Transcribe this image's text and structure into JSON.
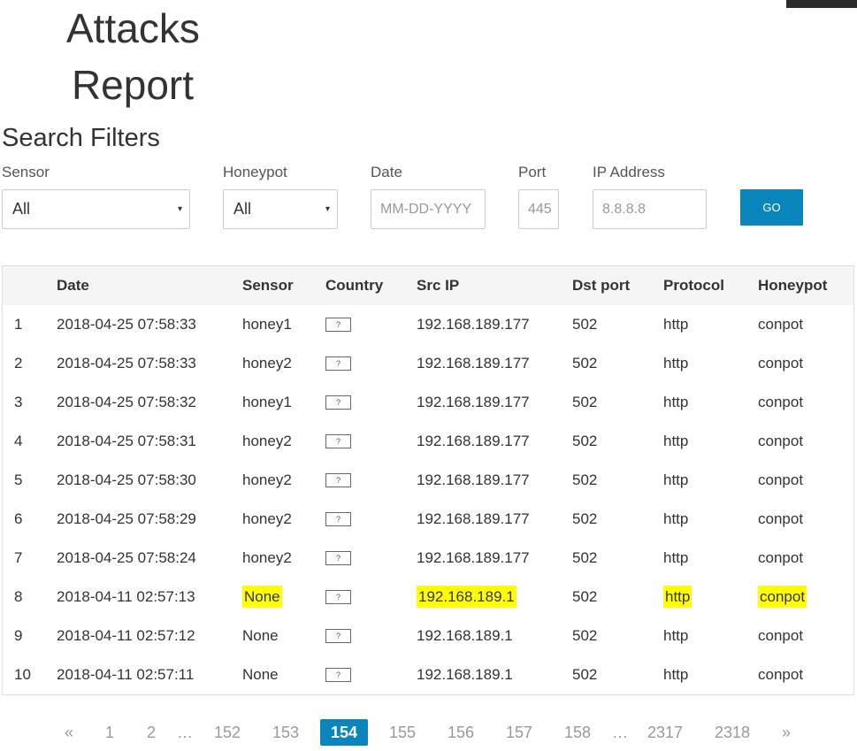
{
  "page": {
    "title_line1": "Attacks",
    "title_line2": "Report",
    "filters_title": "Search Filters"
  },
  "filters": {
    "sensor": {
      "label": "Sensor",
      "value": "All"
    },
    "honeypot": {
      "label": "Honeypot",
      "value": "All"
    },
    "date": {
      "label": "Date",
      "placeholder": "MM-DD-YYYY"
    },
    "port": {
      "label": "Port",
      "placeholder": "445"
    },
    "ip": {
      "label": "IP Address",
      "placeholder": "8.8.8.8"
    },
    "go_label": "GO"
  },
  "table": {
    "headers": [
      "",
      "Date",
      "Sensor",
      "Country",
      "Src IP",
      "Dst port",
      "Protocol",
      "Honeypot"
    ],
    "country_flag_glyph": "?",
    "rows": [
      [
        "1",
        "2018-04-25 07:58:33",
        "honey1",
        "192.168.189.177",
        "502",
        "http",
        "conpot"
      ],
      [
        "2",
        "2018-04-25 07:58:33",
        "honey2",
        "192.168.189.177",
        "502",
        "http",
        "conpot"
      ],
      [
        "3",
        "2018-04-25 07:58:32",
        "honey1",
        "192.168.189.177",
        "502",
        "http",
        "conpot"
      ],
      [
        "4",
        "2018-04-25 07:58:31",
        "honey2",
        "192.168.189.177",
        "502",
        "http",
        "conpot"
      ],
      [
        "5",
        "2018-04-25 07:58:30",
        "honey2",
        "192.168.189.177",
        "502",
        "http",
        "conpot"
      ],
      [
        "6",
        "2018-04-25 07:58:29",
        "honey2",
        "192.168.189.177",
        "502",
        "http",
        "conpot"
      ],
      [
        "7",
        "2018-04-25 07:58:24",
        "honey2",
        "192.168.189.177",
        "502",
        "http",
        "conpot"
      ],
      [
        "8",
        "2018-04-11 02:57:13",
        "None",
        "192.168.189.1",
        "502",
        "http",
        "conpot"
      ],
      [
        "9",
        "2018-04-11 02:57:12",
        "None",
        "192.168.189.1",
        "502",
        "http",
        "conpot"
      ],
      [
        "10",
        "2018-04-11 02:57:11",
        "None",
        "192.168.189.1",
        "502",
        "http",
        "conpot"
      ]
    ],
    "highlight_color": "#ffff00"
  },
  "pagination": {
    "items": [
      "«",
      "1",
      "2",
      "…",
      "152",
      "153",
      "154",
      "155",
      "156",
      "157",
      "158",
      "…",
      "2317",
      "2318",
      "»"
    ],
    "active": "154"
  },
  "colors": {
    "accent": "#0a86bd",
    "header_bg": "#f5f5f5",
    "border": "#dddddd"
  }
}
